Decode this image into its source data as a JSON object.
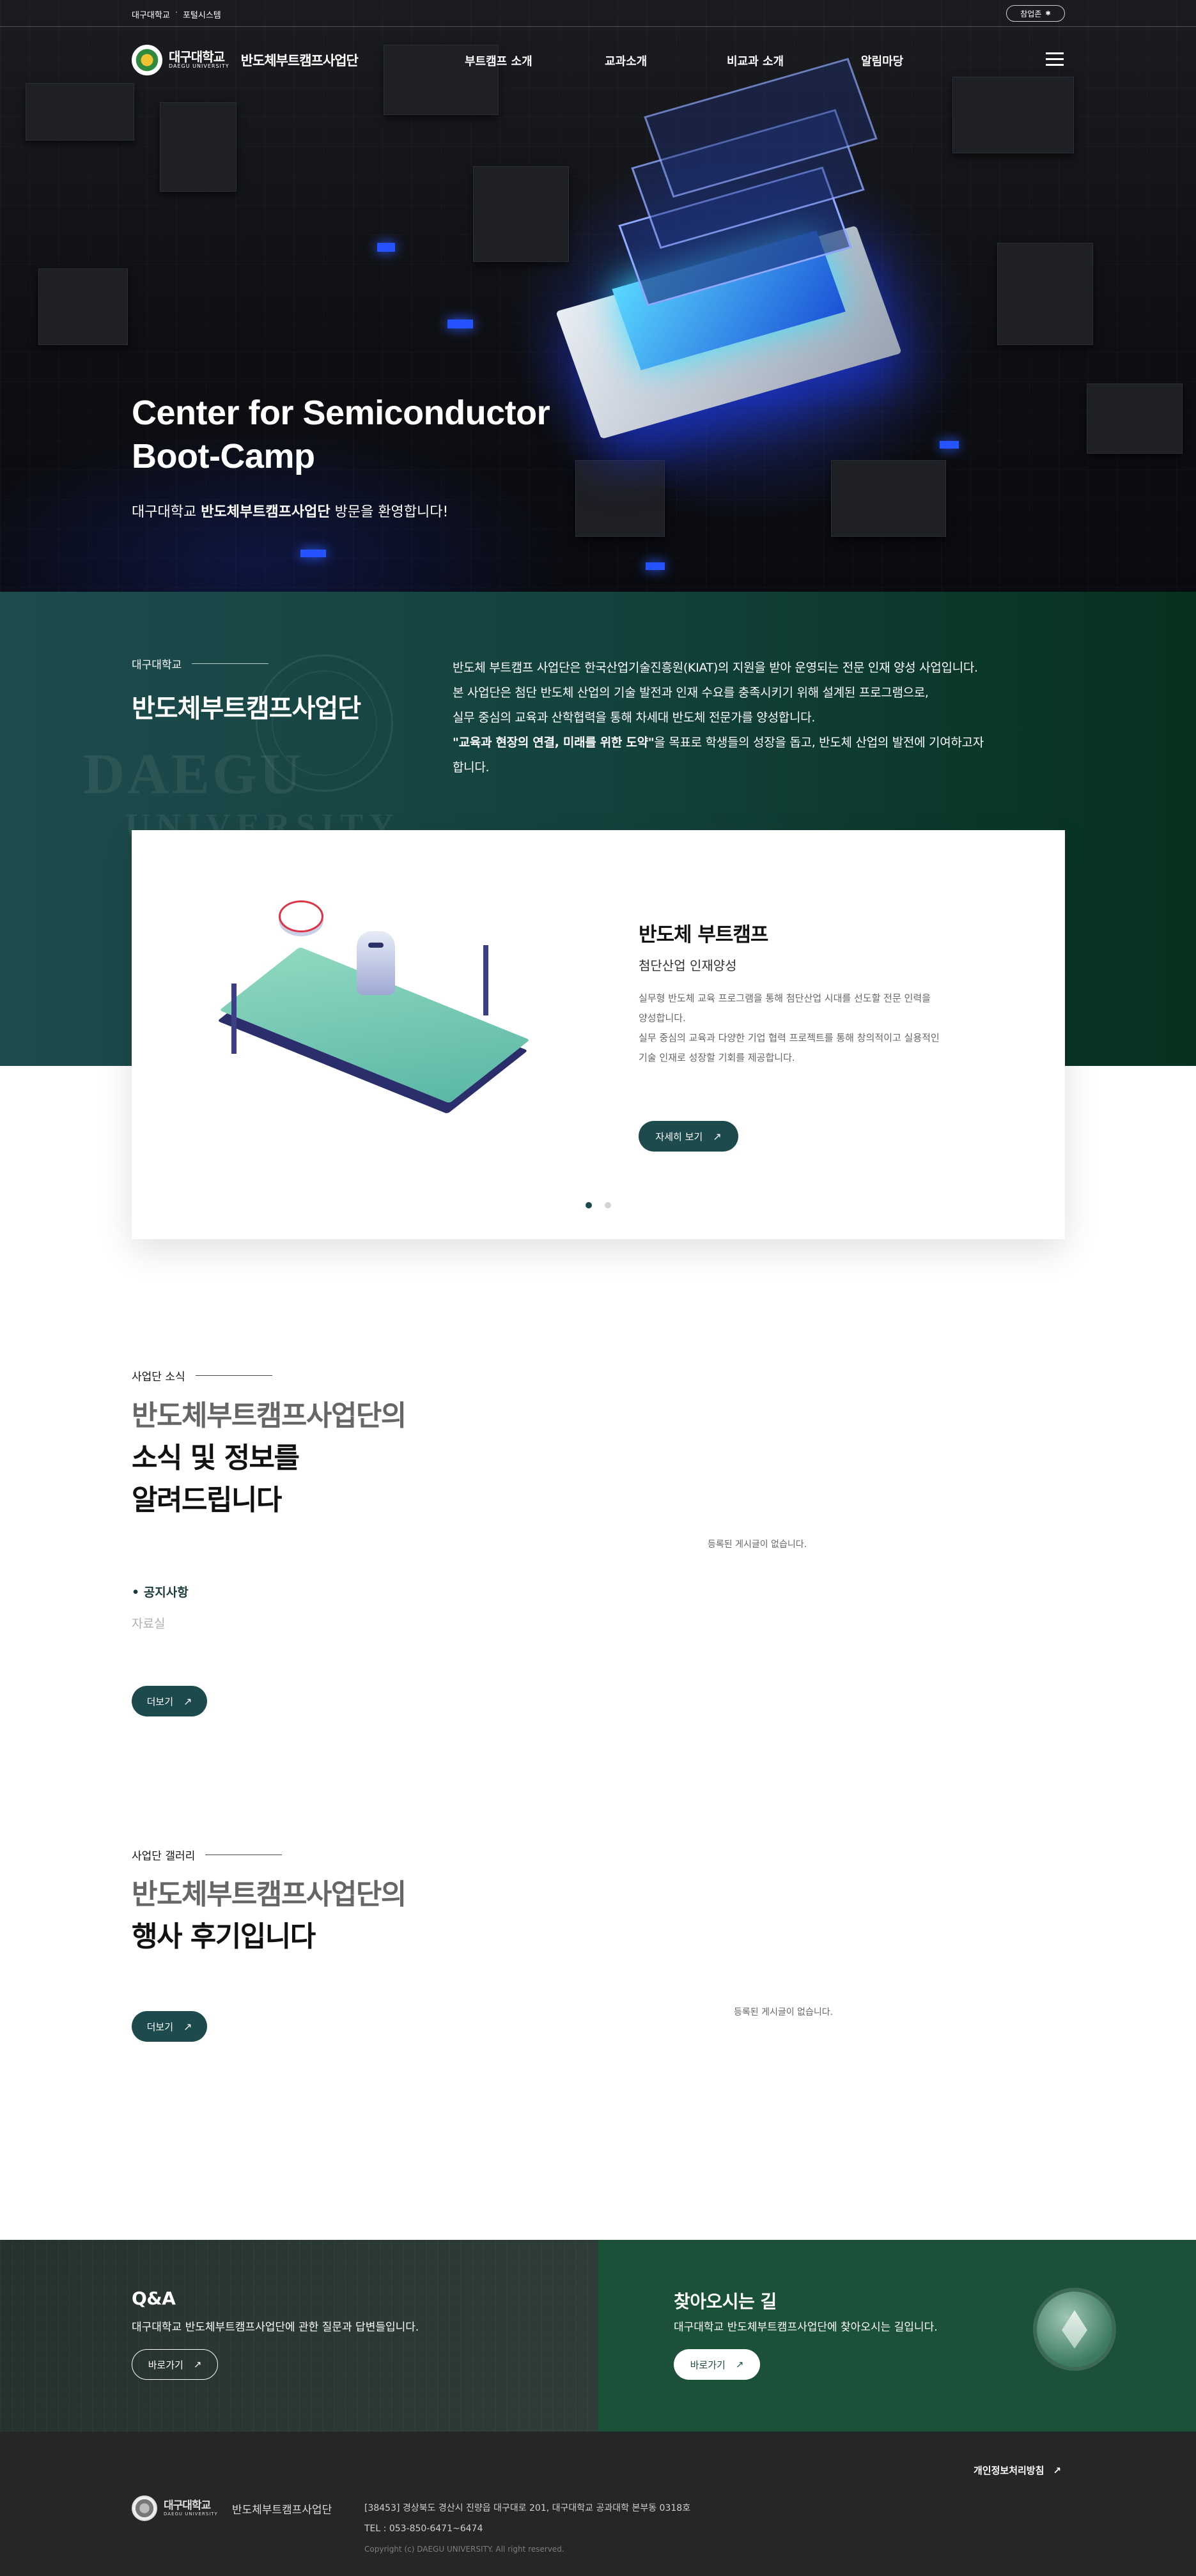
{
  "topbar": {
    "link1": "대구대학교",
    "separator": "·",
    "link2": "포털시스템",
    "sitemap_label": "참업존",
    "sitemap_icon": "gear-icon"
  },
  "header": {
    "logo_ko": "대구대학교",
    "logo_en": "DAEGU UNIVERSITY",
    "logo_sub": "반도체부트캠프사업단",
    "nav": [
      "부트캠프 소개",
      "교과소개",
      "비교과 소개",
      "알림마당"
    ],
    "menu_icon": "hamburger-icon"
  },
  "hero": {
    "title_line1": "Center for Semiconductor",
    "title_line2": "Boot-Camp",
    "welcome_prefix": "대구대학교 ",
    "welcome_bold": "반도체부트캠프사업단",
    "welcome_suffix": " 방문을 환영합니다!"
  },
  "intro": {
    "eyebrow": "대구대학교",
    "title": "반도체부트캠프사업단",
    "watermark_line1": "DAEGU",
    "watermark_line2": "UNIVERSITY",
    "body1": "반도체 부트캠프 사업단은 한국산업기술진흥원(KIAT)의 지원을 받아 운영되는 전문 인재 양성 사업입니다.",
    "body2": "본 사업단은 첨단 반도체 산업의 기술 발전과 인재 수요를 충족시키기 위해 설계된 프로그램으로,",
    "body3": "실무 중심의 교육과 산학협력을 통해 차세대 반도체 전문가를 양성합니다.",
    "body4_bold": "\"교육과 현장의 연결, 미래를 위한 도약\"",
    "body4_rest": "을 목표로 학생들의 성장을 돕고, 반도체 산업의 발전에 기여하고자",
    "body5": "합니다."
  },
  "card": {
    "title": "반도체 부트캠프",
    "subtitle": "첨단산업 인재양성",
    "desc1": "실무형 반도체 교육 프로그램을 통해 첨단산업 시대를 선도할 전문 인력을",
    "desc2": "양성합니다.",
    "desc3": "실무 중심의 교육과 다양한 기업 협력 프로젝트를 통해 창의적이고 실용적인",
    "desc4": "기술 인재로 성장할 기회를 제공합니다.",
    "button": "자세히 보기",
    "button_icon": "arrow-up-right-icon",
    "slides_total": 2,
    "slide_active": 1
  },
  "news": {
    "eyebrow": "사업단 소식",
    "title1": "반도체부트캠프사업단의",
    "title2": "소식 및 정보를",
    "title3": "알려드립니다",
    "tabs": [
      "공지사항",
      "자료실"
    ],
    "active_tab": "공지사항",
    "empty": "등록된 게시글이 없습니다.",
    "more": "더보기"
  },
  "gallery": {
    "eyebrow": "사업단 갤러리",
    "title1": "반도체부트캠프사업단의",
    "title2": "행사 후기입니다",
    "empty": "등록된 게시글이 없습니다.",
    "more": "더보기"
  },
  "qna": {
    "title": "Q&A",
    "desc": "대구대학교 반도체부트캠프사업단에 관한 질문과 답변들입니다.",
    "button": "바로가기"
  },
  "directions": {
    "title": "찾아오시는 길",
    "desc": "대구대학교 반도체부트캠프사업단에 찾아오시는 길입니다.",
    "button": "바로가기",
    "icon": "ethereum-coin-icon"
  },
  "footer": {
    "privacy": "개인정보처리방침",
    "logo_ko": "대구대학교",
    "logo_en": "DAEGU UNIVERSITY",
    "logo_sub": "반도체부트캠프사업단",
    "address": "[38453] 경상북도 경산시 진량읍 대구대로 201, 대구대학교 공과대학 본부동 0318호",
    "tel": "TEL : 053-850-6471~6474",
    "copyright": "Copyright (c) DAEGU UNIVERSITY. All right reserved."
  },
  "colors": {
    "primary": "#1d4a4c",
    "intro_bg_start": "#1e4b4d",
    "intro_bg_end": "#07311f",
    "directions_bg": "#1c5139",
    "footer_bg": "#252628"
  }
}
